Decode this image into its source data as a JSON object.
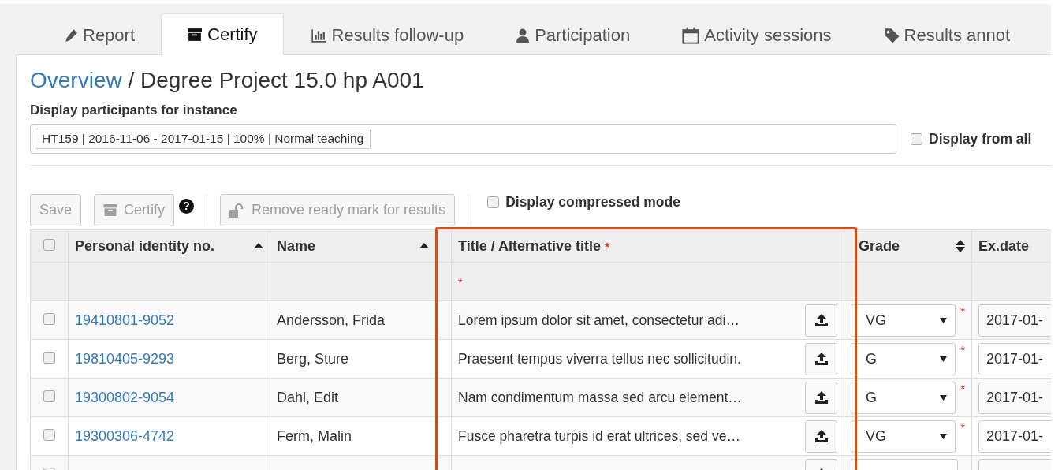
{
  "tabs": [
    {
      "label": "Report",
      "selected": false
    },
    {
      "label": "Certify",
      "selected": true
    },
    {
      "label": "Results follow-up",
      "selected": false
    },
    {
      "label": "Participation",
      "selected": false
    },
    {
      "label": "Activity sessions",
      "selected": false
    },
    {
      "label": "Results annot",
      "selected": false
    }
  ],
  "breadcrumb": {
    "link": "Overview",
    "separator": "/",
    "title": "Degree Project 15.0 hp A001"
  },
  "instance_filter": {
    "label": "Display participants for instance",
    "selected_value": "HT159 | 2016-11-06 - 2017-01-15 | 100% | Normal teaching",
    "display_all": {
      "label": "Display from all",
      "checked": false
    }
  },
  "toolbar": {
    "buttons": [
      {
        "label": "Save",
        "disabled": true
      },
      {
        "label": "Certify",
        "disabled": true
      },
      {
        "label": "Remove ready mark for results",
        "disabled": true
      }
    ],
    "help": "?",
    "compressed_mode": {
      "label": "Display compressed mode",
      "checked": false
    }
  },
  "table": {
    "select_all_checked": false,
    "columns": [
      {
        "label": "Personal identity no.",
        "sortable": true,
        "sorted": true
      },
      {
        "label": "Name",
        "sortable": true,
        "sorted": true
      },
      {
        "label": "Title / Alternative title",
        "required_mark": "*"
      },
      {
        "label": "Grade",
        "sortable": true,
        "sorted": false
      },
      {
        "label": "Ex.date"
      }
    ],
    "filter_required_mark": "*",
    "rows": [
      {
        "checked": false,
        "id": "19410801-9052",
        "name": "Andersson, Frida",
        "title": "Lorem ipsum dolor sit amet, consectetur adi…",
        "grade": "VG",
        "required_mark": "*",
        "date": "2017-01-"
      },
      {
        "checked": false,
        "id": "19810405-9293",
        "name": "Berg, Sture",
        "title": "Praesent tempus viverra tellus nec sollicitudin.",
        "grade": "G",
        "required_mark": "*",
        "date": "2017-01-"
      },
      {
        "checked": false,
        "id": "19300802-9054",
        "name": "Dahl, Edit",
        "title": "Nam condimentum massa sed arcu element…",
        "grade": "G",
        "required_mark": "*",
        "date": "2017-01-"
      },
      {
        "checked": false,
        "id": "19300306-4742",
        "name": "Ferm, Malin",
        "title": "Fusce pharetra turpis id erat ultrices, sed ve…",
        "grade": "VG",
        "required_mark": "*",
        "date": "2017-01-"
      },
      {
        "checked": false
      }
    ]
  }
}
